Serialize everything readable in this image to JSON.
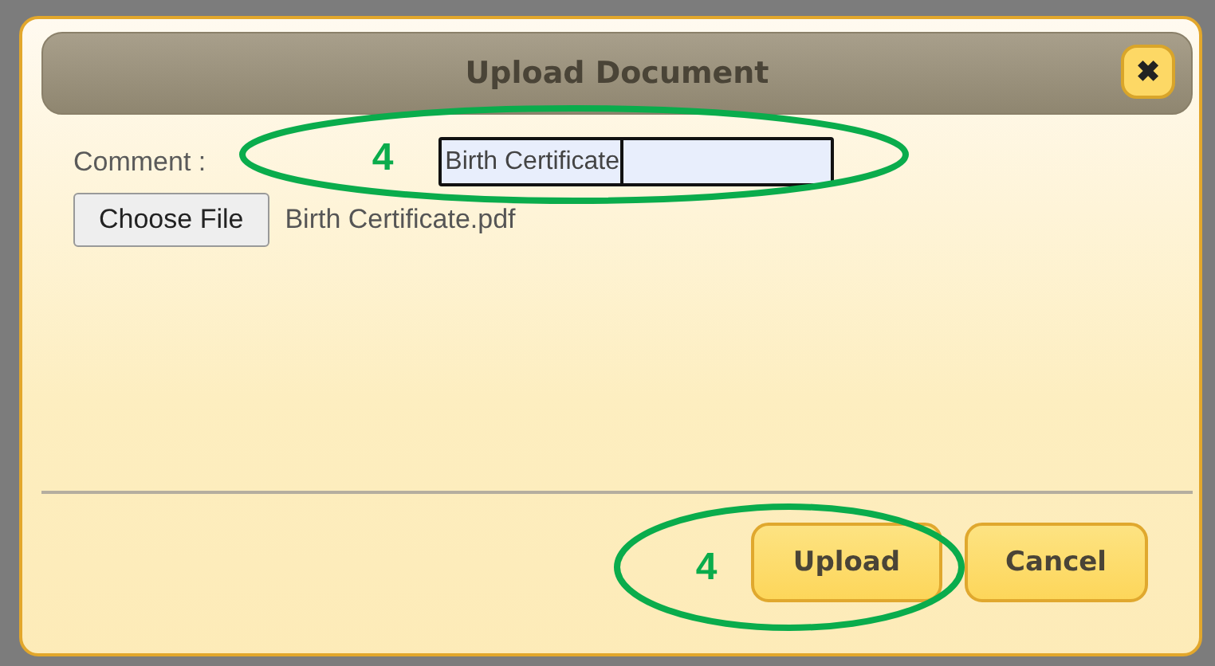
{
  "dialog": {
    "title": "Upload Document",
    "close_label": "✖"
  },
  "form": {
    "comment_label": "Comment :",
    "comment_value": "Birth Certificate",
    "file_button": "Choose File",
    "file_name": "Birth Certificate.pdf"
  },
  "buttons": [
    {
      "label": "Upload"
    },
    {
      "label": "Cancel"
    }
  ],
  "annotations": [
    {
      "label": "4"
    },
    {
      "label": "4"
    }
  ]
}
